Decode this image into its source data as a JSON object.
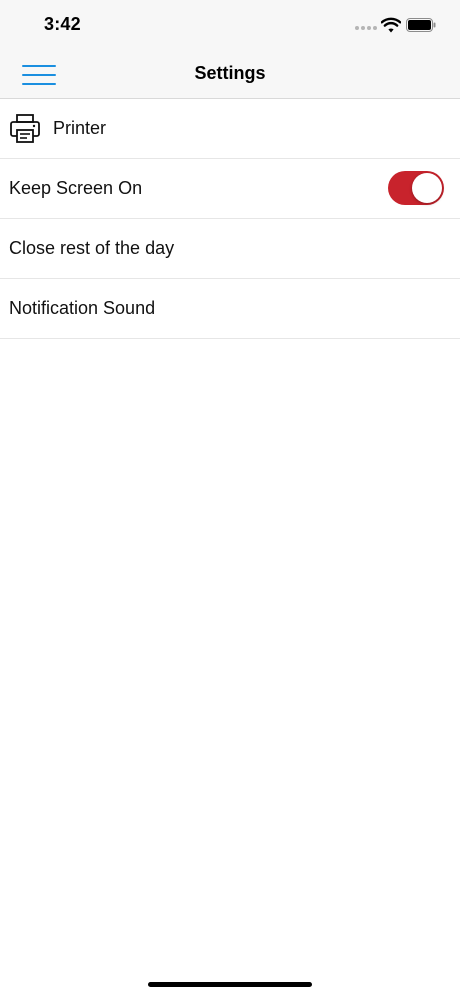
{
  "status_bar": {
    "time": "3:42",
    "icons": [
      "signal-dots-icon",
      "wifi-icon",
      "battery-icon"
    ]
  },
  "nav": {
    "title": "Settings",
    "menu_icon": "hamburger-menu-icon",
    "accent_color": "#1a8fe0"
  },
  "settings": {
    "items": [
      {
        "label": "Printer",
        "icon": "printer-icon"
      },
      {
        "label": "Keep Screen On",
        "toggle_on": true,
        "toggle_color": "#c8232c"
      },
      {
        "label": "Close rest of the day"
      },
      {
        "label": "Notification Sound"
      }
    ]
  }
}
